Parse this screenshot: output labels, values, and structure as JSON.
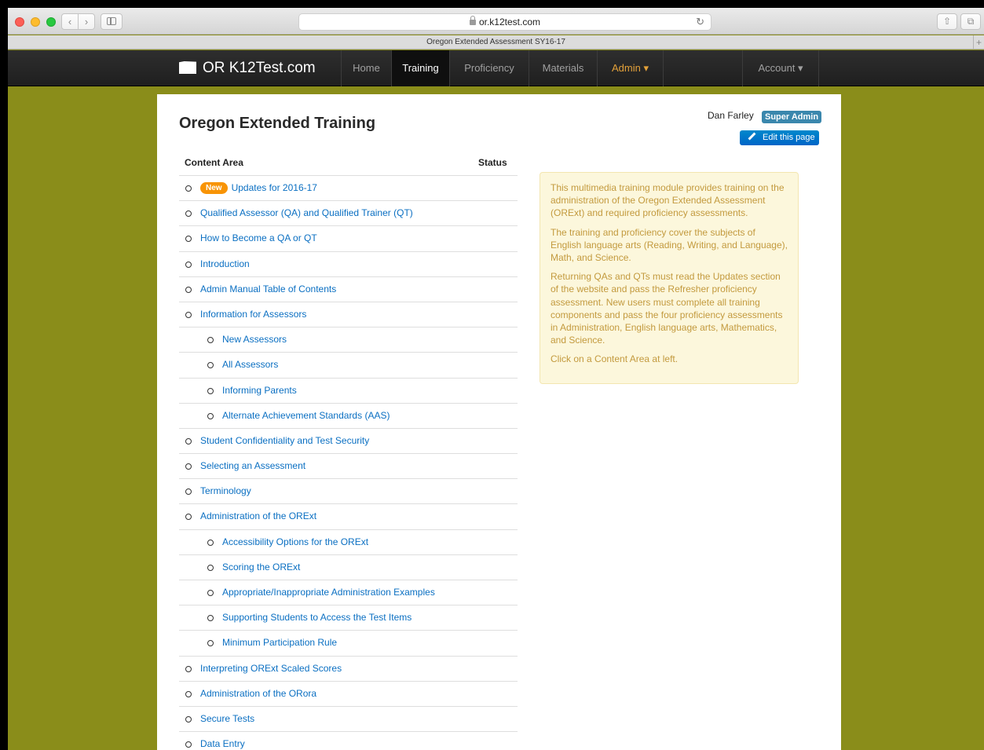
{
  "browser": {
    "url": "or.k12test.com",
    "tab_title": "Oregon Extended Assessment SY16-17",
    "back_glyph": "‹",
    "forward_glyph": "›",
    "reload_glyph": "↻",
    "share_glyph": "⇧",
    "tabs_glyph": "⧉",
    "new_tab_glyph": "+"
  },
  "navbar": {
    "brand": "OR K12Test.com",
    "items": [
      {
        "label": "Home"
      },
      {
        "label": "Training"
      },
      {
        "label": "Proficiency"
      },
      {
        "label": "Materials"
      },
      {
        "label": "Admin ▾"
      },
      {
        "label": "Account ▾"
      }
    ],
    "active": "Training"
  },
  "page": {
    "title": "Oregon Extended Training",
    "user_name": "Dan Farley",
    "role_badge": "Super Admin",
    "edit_button": "Edit this page"
  },
  "table": {
    "col_content_area": "Content Area",
    "col_status": "Status",
    "rows": [
      {
        "label": "Updates for 2016-17",
        "level": 0,
        "badge": "New"
      },
      {
        "label": "Qualified Assessor (QA) and Qualified Trainer (QT)",
        "level": 0
      },
      {
        "label": "How to Become a QA or QT",
        "level": 0
      },
      {
        "label": "Introduction",
        "level": 0
      },
      {
        "label": "Admin Manual Table of Contents",
        "level": 0
      },
      {
        "label": "Information for Assessors",
        "level": 0
      },
      {
        "label": "New Assessors",
        "level": 1
      },
      {
        "label": "All Assessors",
        "level": 1
      },
      {
        "label": "Informing Parents",
        "level": 1
      },
      {
        "label": "Alternate Achievement Standards (AAS)",
        "level": 1
      },
      {
        "label": "Student Confidentiality and Test Security",
        "level": 0
      },
      {
        "label": "Selecting an Assessment",
        "level": 0
      },
      {
        "label": "Terminology",
        "level": 0
      },
      {
        "label": "Administration of the ORExt",
        "level": 0
      },
      {
        "label": "Accessibility Options for the ORExt",
        "level": 1
      },
      {
        "label": "Scoring the ORExt",
        "level": 1
      },
      {
        "label": "Appropriate/Inappropriate Administration Examples",
        "level": 1
      },
      {
        "label": "Supporting Students to Access the Test Items",
        "level": 1
      },
      {
        "label": "Minimum Participation Rule",
        "level": 1
      },
      {
        "label": "Interpreting ORExt Scaled Scores",
        "level": 0
      },
      {
        "label": "Administration of the ORora",
        "level": 0
      },
      {
        "label": "Secure Tests",
        "level": 0
      },
      {
        "label": "Data Entry",
        "level": 0
      }
    ]
  },
  "info": {
    "paragraphs": [
      "This multimedia training module provides training on the administration of the Oregon Extended Assessment (ORExt) and required proficiency assessments.",
      "The training and proficiency cover the subjects of English language arts (Reading, Writing, and Language), Math, and Science.",
      "Returning QAs and QTs must read the Updates section of the website and pass the Refresher proficiency assessment. New users must complete all training components and pass the four proficiency assessments in Administration, English language arts, Mathematics, and Science.",
      "Click on a Content Area at left."
    ]
  },
  "colors": {
    "background": "#8a8d1a",
    "link": "#0a6fc2",
    "badge_new": "#f89406",
    "badge_role": "#3a87ad",
    "admin_nav": "#e3a13a",
    "info_text": "#c39a3e"
  }
}
